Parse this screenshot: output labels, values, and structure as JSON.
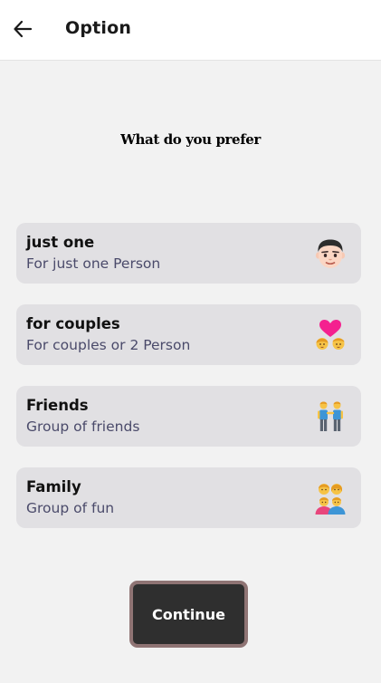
{
  "header": {
    "back_icon": "back-arrow-icon",
    "title": "Option"
  },
  "question": "What do you prefer",
  "options": [
    {
      "title": "just one",
      "subtitle": "For just one Person",
      "icon": "man-face-emoji"
    },
    {
      "title": "for couples",
      "subtitle": "For couples or 2 Person",
      "icon": "couple-with-heart-emoji"
    },
    {
      "title": "Friends",
      "subtitle": "Group of friends",
      "icon": "two-men-holding-hands-emoji"
    },
    {
      "title": "Family",
      "subtitle": "Group of fun",
      "icon": "family-emoji"
    }
  ],
  "continue_label": "Continue",
  "colors": {
    "card_bg": "#e1e0e3",
    "subtitle_text": "#4a4a6a",
    "button_bg": "#2f2f2f",
    "button_border": "#8f7474"
  }
}
